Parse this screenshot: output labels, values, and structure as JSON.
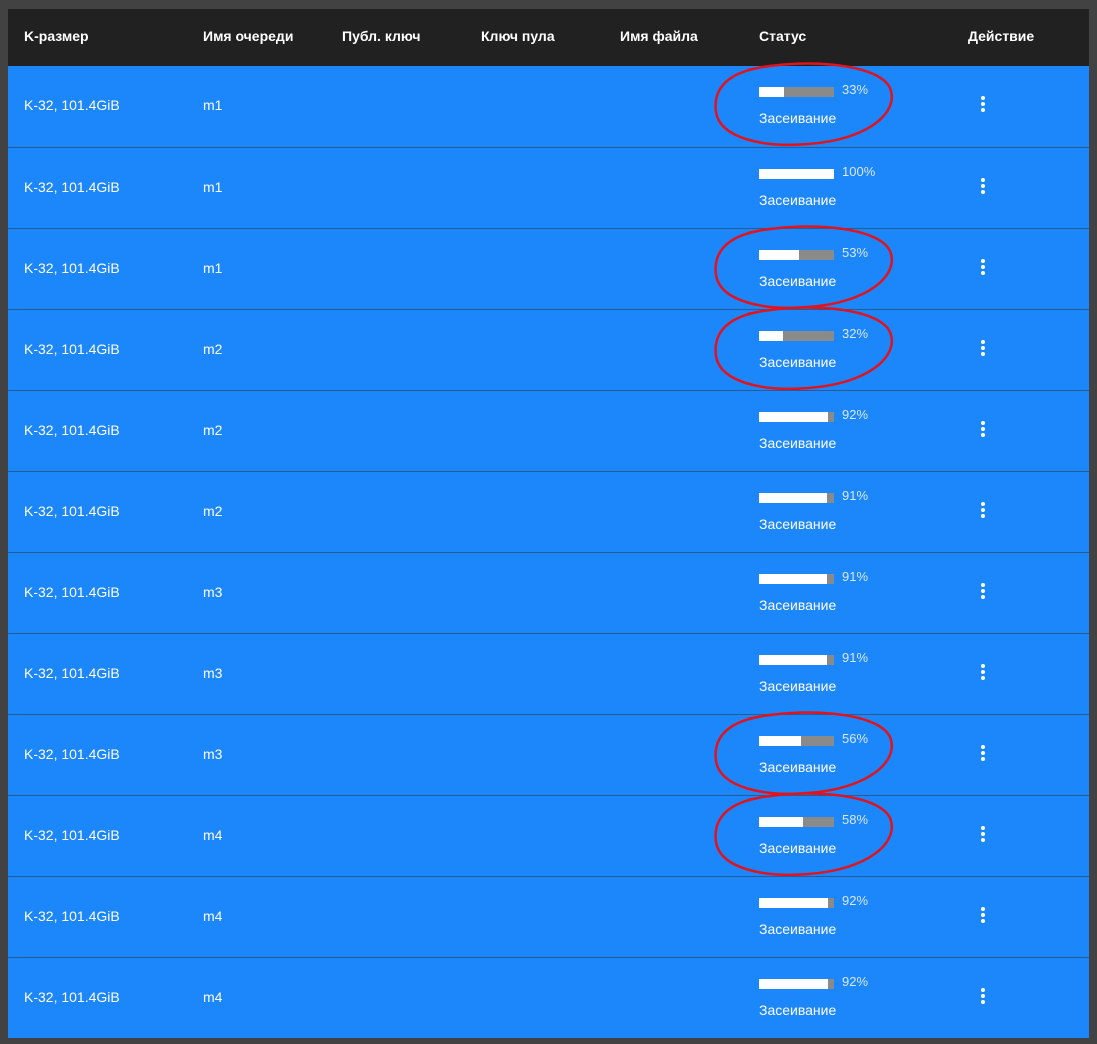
{
  "table": {
    "headers": {
      "ksize": "K-размер",
      "queue": "Имя очереди",
      "pubkey": "Публ. ключ",
      "poolkey": "Ключ пула",
      "filename": "Имя файла",
      "status": "Статус",
      "action": "Действие"
    },
    "rows": [
      {
        "ksize": "K-32, 101.4GiB",
        "queue": "m1",
        "progress": 33,
        "pct": "33%",
        "state": "Засеивание",
        "highlighted": true
      },
      {
        "ksize": "K-32, 101.4GiB",
        "queue": "m1",
        "progress": 100,
        "pct": "100%",
        "state": "Засеивание",
        "highlighted": false
      },
      {
        "ksize": "K-32, 101.4GiB",
        "queue": "m1",
        "progress": 53,
        "pct": "53%",
        "state": "Засеивание",
        "highlighted": true
      },
      {
        "ksize": "K-32, 101.4GiB",
        "queue": "m2",
        "progress": 32,
        "pct": "32%",
        "state": "Засеивание",
        "highlighted": true
      },
      {
        "ksize": "K-32, 101.4GiB",
        "queue": "m2",
        "progress": 92,
        "pct": "92%",
        "state": "Засеивание",
        "highlighted": false
      },
      {
        "ksize": "K-32, 101.4GiB",
        "queue": "m2",
        "progress": 91,
        "pct": "91%",
        "state": "Засеивание",
        "highlighted": false
      },
      {
        "ksize": "K-32, 101.4GiB",
        "queue": "m3",
        "progress": 91,
        "pct": "91%",
        "state": "Засеивание",
        "highlighted": false
      },
      {
        "ksize": "K-32, 101.4GiB",
        "queue": "m3",
        "progress": 91,
        "pct": "91%",
        "state": "Засеивание",
        "highlighted": false
      },
      {
        "ksize": "K-32, 101.4GiB",
        "queue": "m3",
        "progress": 56,
        "pct": "56%",
        "state": "Засеивание",
        "highlighted": true
      },
      {
        "ksize": "K-32, 101.4GiB",
        "queue": "m4",
        "progress": 58,
        "pct": "58%",
        "state": "Засеивание",
        "highlighted": true
      },
      {
        "ksize": "K-32, 101.4GiB",
        "queue": "m4",
        "progress": 92,
        "pct": "92%",
        "state": "Засеивание",
        "highlighted": false
      },
      {
        "ksize": "K-32, 101.4GiB",
        "queue": "m4",
        "progress": 92,
        "pct": "92%",
        "state": "Засеивание",
        "highlighted": false
      }
    ],
    "action_icon": "more-vertical-icon"
  },
  "colors": {
    "row_bg": "#1c86fb",
    "header_bg": "#212121",
    "annotation": "#e0141e"
  }
}
